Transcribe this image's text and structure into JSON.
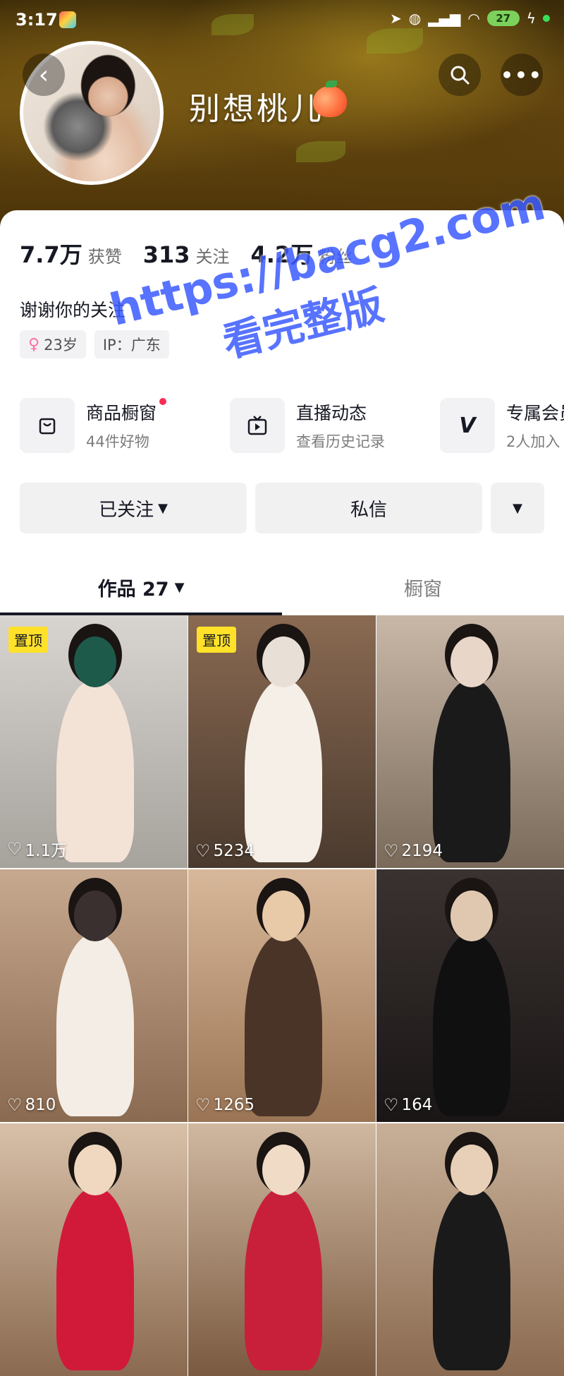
{
  "status_bar": {
    "time": "3:17",
    "battery": "27"
  },
  "profile": {
    "nickname": "别想桃儿",
    "stats": [
      {
        "num": "7.7万",
        "label": "获赞"
      },
      {
        "num": "313",
        "label": "关注"
      },
      {
        "num": "4.2万",
        "label": "粉丝"
      }
    ],
    "bio": "谢谢你的关注",
    "tags": {
      "age": "23岁",
      "ip": "IP：广东"
    }
  },
  "entries": [
    {
      "title": "商品橱窗",
      "sub": "44件好物"
    },
    {
      "title": "直播动态",
      "sub": "查看历史记录"
    },
    {
      "title": "专属会员",
      "sub": "2人加入"
    }
  ],
  "actions": {
    "followed": "已关注",
    "message": "私信"
  },
  "tabs": {
    "works": "作品 27",
    "shop": "橱窗"
  },
  "grid": {
    "pin_label": "置顶",
    "items": [
      {
        "likes": "1.1万",
        "pinned": true
      },
      {
        "likes": "5234",
        "pinned": true
      },
      {
        "likes": "2194",
        "pinned": false
      },
      {
        "likes": "810",
        "pinned": false
      },
      {
        "likes": "1265",
        "pinned": false
      },
      {
        "likes": "164",
        "pinned": false
      },
      {
        "likes": "",
        "pinned": false
      },
      {
        "likes": "",
        "pinned": false
      },
      {
        "likes": "",
        "pinned": false
      }
    ]
  },
  "watermark": {
    "url": "https://bacg2.com",
    "text": "看完整版"
  }
}
